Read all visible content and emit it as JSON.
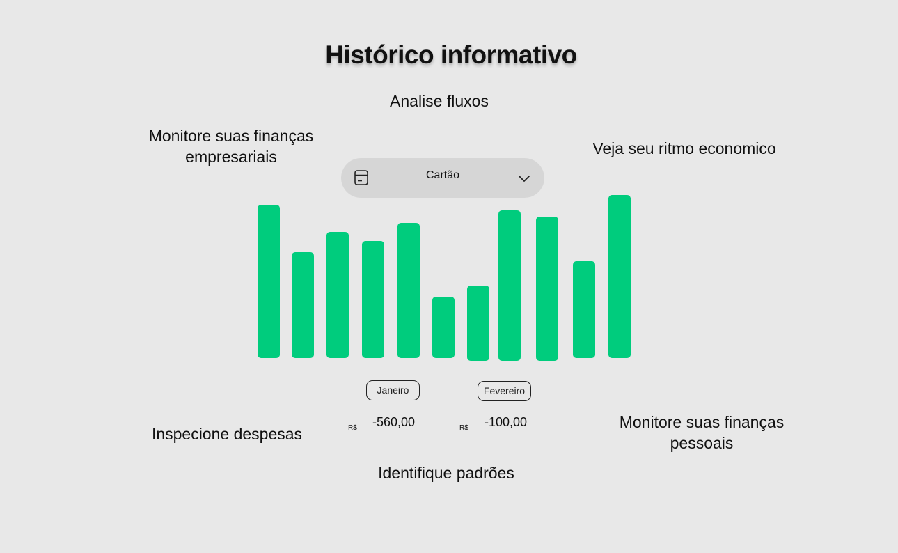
{
  "page": {
    "title": "Histórico informativo"
  },
  "captions": {
    "fluxos": "Analise fluxos",
    "empresariais": "Monitore suas finanças empresariais",
    "ritmo": "Veja seu ritmo economico",
    "despesas": "Inspecione despesas",
    "pessoais": "Monitore suas finanças pessoais",
    "padroes": "Identifique padrões"
  },
  "selector": {
    "label": "Cartão",
    "icon": "card-icon",
    "dropdown_icon": "chevron-down-icon"
  },
  "months": [
    {
      "label": "Janeiro",
      "currency": "R$",
      "amount": "-560,00"
    },
    {
      "label": "Fevereiro",
      "currency": "R$",
      "amount": "-100,00"
    }
  ],
  "colors": {
    "bar": "#00cc7d",
    "background": "#e8e8e8",
    "selector_bg": "#d6d6d6"
  },
  "chart_data": {
    "type": "bar",
    "title": "",
    "xlabel": "",
    "ylabel": "",
    "categories": [
      "",
      "",
      "",
      "",
      "",
      "",
      "",
      "",
      "",
      "",
      ""
    ],
    "values": [
      220,
      152,
      181,
      168,
      194,
      88,
      108,
      216,
      207,
      139,
      234
    ],
    "ylim": [
      0,
      234
    ],
    "grid": false,
    "legend": "none"
  }
}
